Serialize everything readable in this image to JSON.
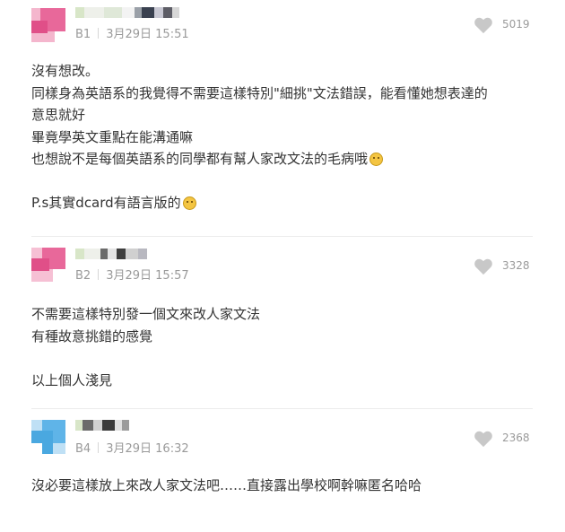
{
  "comments": [
    {
      "floor": "B1",
      "date": "3月29日 15:51",
      "likes": "5019",
      "avatar_color": "#e8689a",
      "lines": [
        "沒有想改。",
        "同樣身為英語系的我覺得不需要這樣特別\"細挑\"文法錯誤，能看懂她想表達的",
        "意思就好",
        "畢竟學英文重點在能溝通嘛",
        "也想說不是每個英語系的同學都有幫人家改文法的毛病哦",
        "",
        "P.s其實dcard有語言版的"
      ]
    },
    {
      "floor": "B2",
      "date": "3月29日 15:57",
      "likes": "3328",
      "avatar_color": "#e8689a",
      "lines": [
        "不需要這樣特別發一個文來改人家文法",
        "有種故意挑錯的感覺",
        "",
        "以上個人淺見"
      ]
    },
    {
      "floor": "B4",
      "date": "3月29日 16:32",
      "likes": "2368",
      "avatar_color": "#4aa8e0",
      "lines": [
        "沒必要這樣放上來改人家文法吧……直接露出學校啊幹嘛匿名哈哈"
      ]
    }
  ],
  "icons": {
    "like": "heart-icon",
    "emoji": "smiley-emoji-icon"
  },
  "colors": {
    "text": "#333333",
    "meta": "#9a9a9a",
    "heart": "#c8c8c8"
  }
}
